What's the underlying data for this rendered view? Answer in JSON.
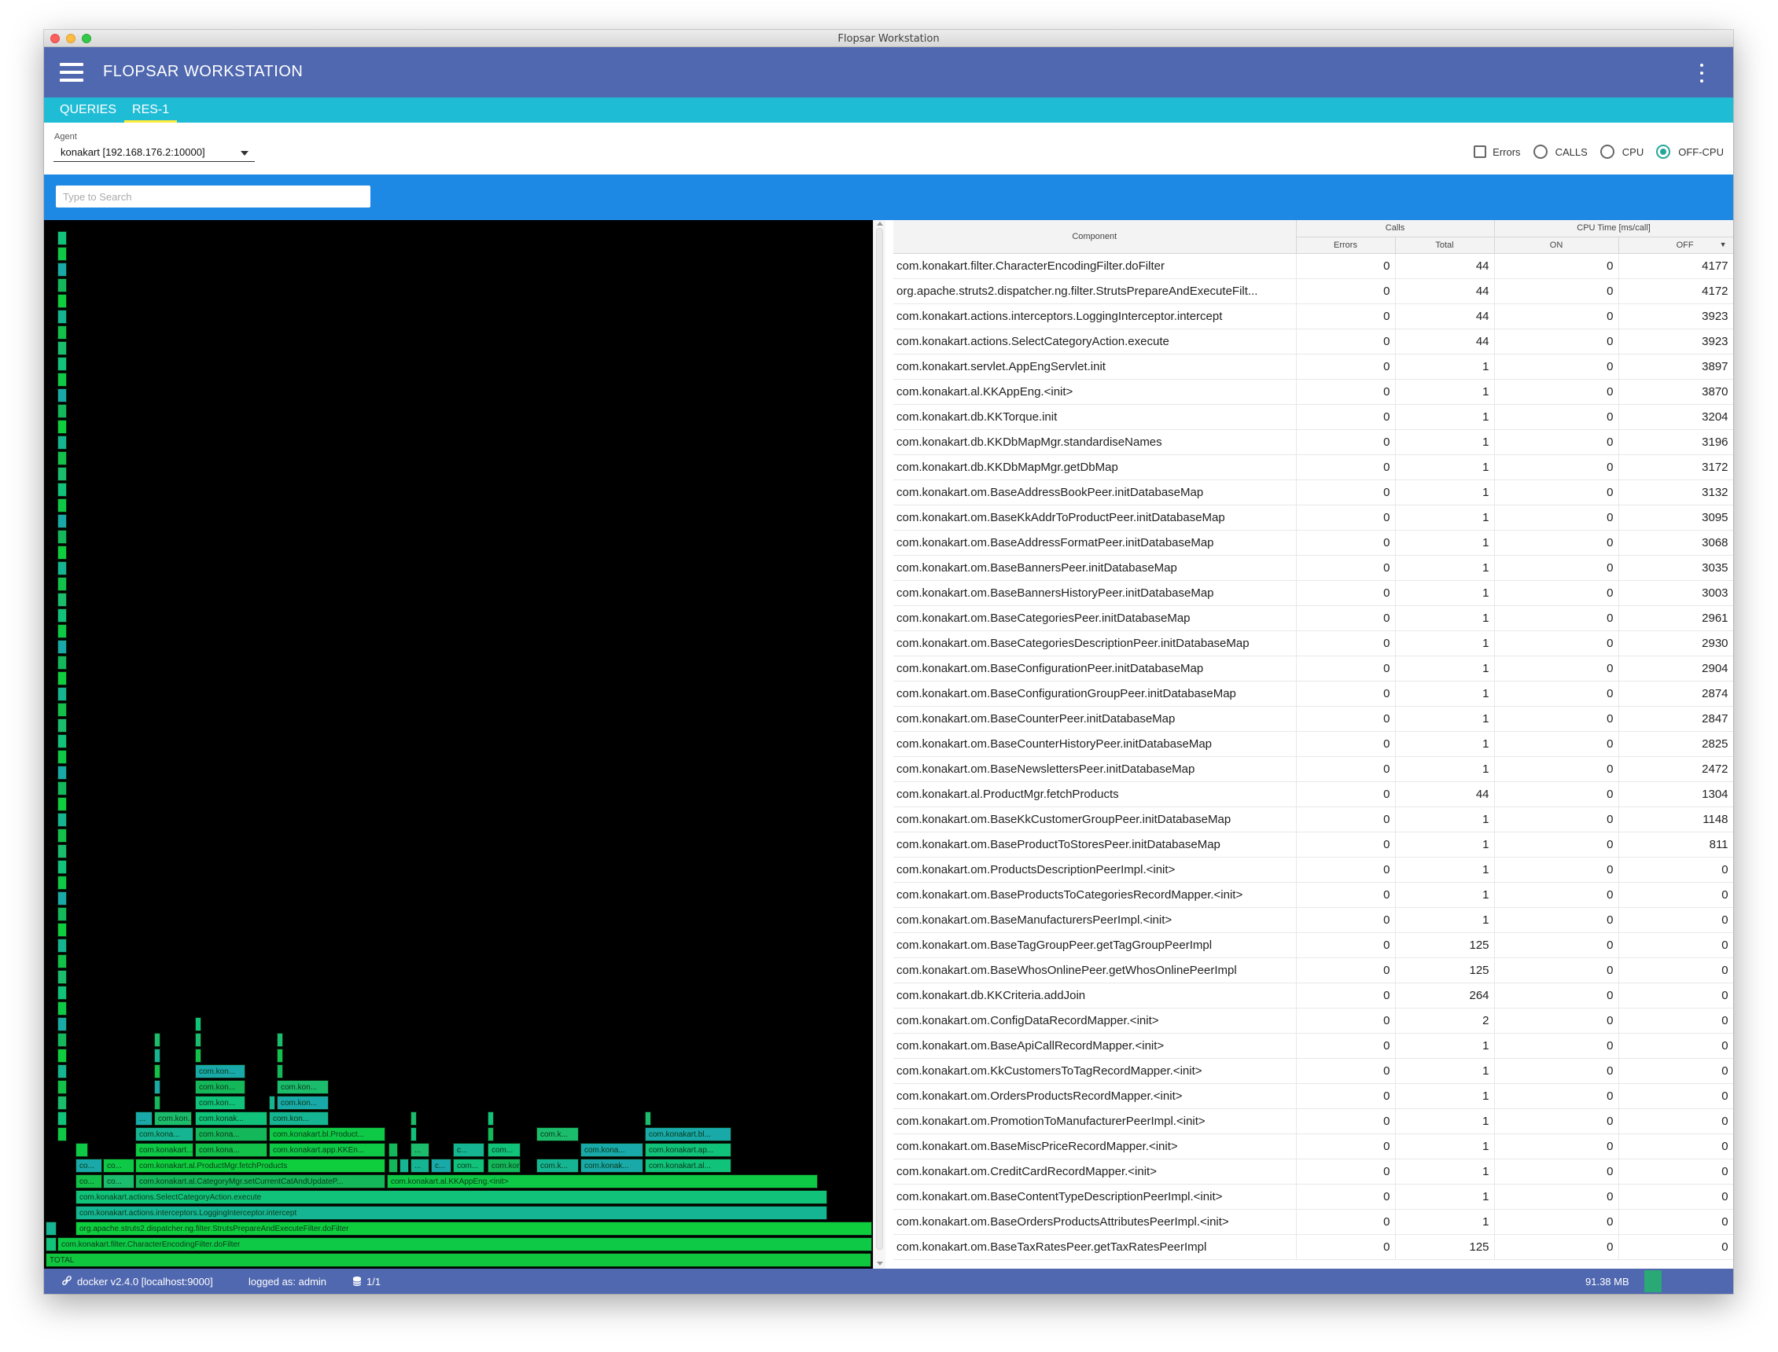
{
  "window": {
    "title": "Flopsar Workstation"
  },
  "appbar": {
    "title": "FLOPSAR WORKSTATION"
  },
  "tabs": [
    {
      "label": "QUERIES",
      "active": false
    },
    {
      "label": "RES-1",
      "active": true
    }
  ],
  "agent": {
    "label": "Agent",
    "value": "konakart [192.168.176.2:10000]"
  },
  "options": {
    "errors": {
      "label": "Errors",
      "checked": false
    },
    "modes": [
      {
        "label": "CALLS",
        "selected": false
      },
      {
        "label": "CPU",
        "selected": false
      },
      {
        "label": "OFF-CPU",
        "selected": true
      }
    ]
  },
  "search": {
    "placeholder": "Type to Search",
    "value": ""
  },
  "table": {
    "headers": {
      "component": "Component",
      "calls": "Calls",
      "cpu_time": "CPU Time [ms/call]",
      "errors": "Errors",
      "total": "Total",
      "on": "ON",
      "off": "OFF",
      "sort_indicator": "▼"
    },
    "rows": [
      [
        "com.konakart.filter.CharacterEncodingFilter.doFilter",
        "0",
        "44",
        "0",
        "4177"
      ],
      [
        "org.apache.struts2.dispatcher.ng.filter.StrutsPrepareAndExecuteFilt...",
        "0",
        "44",
        "0",
        "4172"
      ],
      [
        "com.konakart.actions.interceptors.LoggingInterceptor.intercept",
        "0",
        "44",
        "0",
        "3923"
      ],
      [
        "com.konakart.actions.SelectCategoryAction.execute",
        "0",
        "44",
        "0",
        "3923"
      ],
      [
        "com.konakart.servlet.AppEngServlet.init",
        "0",
        "1",
        "0",
        "3897"
      ],
      [
        "com.konakart.al.KKAppEng.<init>",
        "0",
        "1",
        "0",
        "3870"
      ],
      [
        "com.konakart.db.KKTorque.init",
        "0",
        "1",
        "0",
        "3204"
      ],
      [
        "com.konakart.db.KKDbMapMgr.standardiseNames",
        "0",
        "1",
        "0",
        "3196"
      ],
      [
        "com.konakart.db.KKDbMapMgr.getDbMap",
        "0",
        "1",
        "0",
        "3172"
      ],
      [
        "com.konakart.om.BaseAddressBookPeer.initDatabaseMap",
        "0",
        "1",
        "0",
        "3132"
      ],
      [
        "com.konakart.om.BaseKkAddrToProductPeer.initDatabaseMap",
        "0",
        "1",
        "0",
        "3095"
      ],
      [
        "com.konakart.om.BaseAddressFormatPeer.initDatabaseMap",
        "0",
        "1",
        "0",
        "3068"
      ],
      [
        "com.konakart.om.BaseBannersPeer.initDatabaseMap",
        "0",
        "1",
        "0",
        "3035"
      ],
      [
        "com.konakart.om.BaseBannersHistoryPeer.initDatabaseMap",
        "0",
        "1",
        "0",
        "3003"
      ],
      [
        "com.konakart.om.BaseCategoriesPeer.initDatabaseMap",
        "0",
        "1",
        "0",
        "2961"
      ],
      [
        "com.konakart.om.BaseCategoriesDescriptionPeer.initDatabaseMap",
        "0",
        "1",
        "0",
        "2930"
      ],
      [
        "com.konakart.om.BaseConfigurationPeer.initDatabaseMap",
        "0",
        "1",
        "0",
        "2904"
      ],
      [
        "com.konakart.om.BaseConfigurationGroupPeer.initDatabaseMap",
        "0",
        "1",
        "0",
        "2874"
      ],
      [
        "com.konakart.om.BaseCounterPeer.initDatabaseMap",
        "0",
        "1",
        "0",
        "2847"
      ],
      [
        "com.konakart.om.BaseCounterHistoryPeer.initDatabaseMap",
        "0",
        "1",
        "0",
        "2825"
      ],
      [
        "com.konakart.om.BaseNewslettersPeer.initDatabaseMap",
        "0",
        "1",
        "0",
        "2472"
      ],
      [
        "com.konakart.al.ProductMgr.fetchProducts",
        "0",
        "44",
        "0",
        "1304"
      ],
      [
        "com.konakart.om.BaseKkCustomerGroupPeer.initDatabaseMap",
        "0",
        "1",
        "0",
        "1148"
      ],
      [
        "com.konakart.om.BaseProductToStoresPeer.initDatabaseMap",
        "0",
        "1",
        "0",
        "811"
      ],
      [
        "com.konakart.om.ProductsDescriptionPeerImpl.<init>",
        "0",
        "1",
        "0",
        "0"
      ],
      [
        "com.konakart.om.BaseProductsToCategoriesRecordMapper.<init>",
        "0",
        "1",
        "0",
        "0"
      ],
      [
        "com.konakart.om.BaseManufacturersPeerImpl.<init>",
        "0",
        "1",
        "0",
        "0"
      ],
      [
        "com.konakart.om.BaseTagGroupPeer.getTagGroupPeerImpl",
        "0",
        "125",
        "0",
        "0"
      ],
      [
        "com.konakart.om.BaseWhosOnlinePeer.getWhosOnlinePeerImpl",
        "0",
        "125",
        "0",
        "0"
      ],
      [
        "com.konakart.db.KKCriteria.addJoin",
        "0",
        "264",
        "0",
        "0"
      ],
      [
        "com.konakart.om.ConfigDataRecordMapper.<init>",
        "0",
        "2",
        "0",
        "0"
      ],
      [
        "com.konakart.om.BaseApiCallRecordMapper.<init>",
        "0",
        "1",
        "0",
        "0"
      ],
      [
        "com.konakart.om.KkCustomersToTagRecordMapper.<init>",
        "0",
        "1",
        "0",
        "0"
      ],
      [
        "com.konakart.om.OrdersProductsRecordMapper.<init>",
        "0",
        "1",
        "0",
        "0"
      ],
      [
        "com.konakart.om.PromotionToManufacturerPeerImpl.<init>",
        "0",
        "1",
        "0",
        "0"
      ],
      [
        "com.konakart.om.BaseMiscPriceRecordMapper.<init>",
        "0",
        "1",
        "0",
        "0"
      ],
      [
        "com.konakart.om.CreditCardRecordMapper.<init>",
        "0",
        "1",
        "0",
        "0"
      ],
      [
        "com.konakart.om.BaseContentTypeDescriptionPeerImpl.<init>",
        "0",
        "1",
        "0",
        "0"
      ],
      [
        "com.konakart.om.BaseOrdersProductsAttributesPeerImpl.<init>",
        "0",
        "1",
        "0",
        "0"
      ],
      [
        "com.konakart.om.BaseTaxRatesPeer.getTaxRatesPeerImpl",
        "0",
        "125",
        "0",
        "0"
      ]
    ]
  },
  "flame": {
    "total_label": "TOTAL",
    "frame_labels": [
      "com.konakart.filter.CharacterEncodingFilter.doFilter",
      "org.apache.struts2.dispatcher.ng.filter.StrutsPrepareAndExecuteFilter.doFilter",
      "com.konakart.actions.interceptors.LoggingInterceptor.intercept",
      "com.konakart.actions.SelectCategoryAction.execute",
      "com.konakart.al.CategoryMgr.setCurrentCatAndUpdateP...",
      "com.konakart.al.KKAppEng.<init>",
      "com.konakart.al.ProductMgr.fetchProducts",
      "com.konakart.bl.Product...",
      "com.konakart.app.KKEn...",
      "com.konakart...",
      "com.kona...",
      "com.kon...",
      "com.k...",
      "com.konak...",
      "com.kona...",
      "com.konakart.ap...",
      "com.konakart.bl...",
      "com.konakart.al...",
      "co...",
      "c...",
      "...",
      "com..."
    ]
  },
  "status": {
    "server": "docker v2.4.0 [localhost:9000]",
    "user": "logged as: admin",
    "db": "1/1",
    "memory": "91.38 MB"
  },
  "colors": {
    "appbar": "#5068b0",
    "tabs": "#1fbcd6",
    "searchbar": "#1e88e5",
    "tab_indicator": "#ffeb3b",
    "radio_on": "#26a69a"
  }
}
